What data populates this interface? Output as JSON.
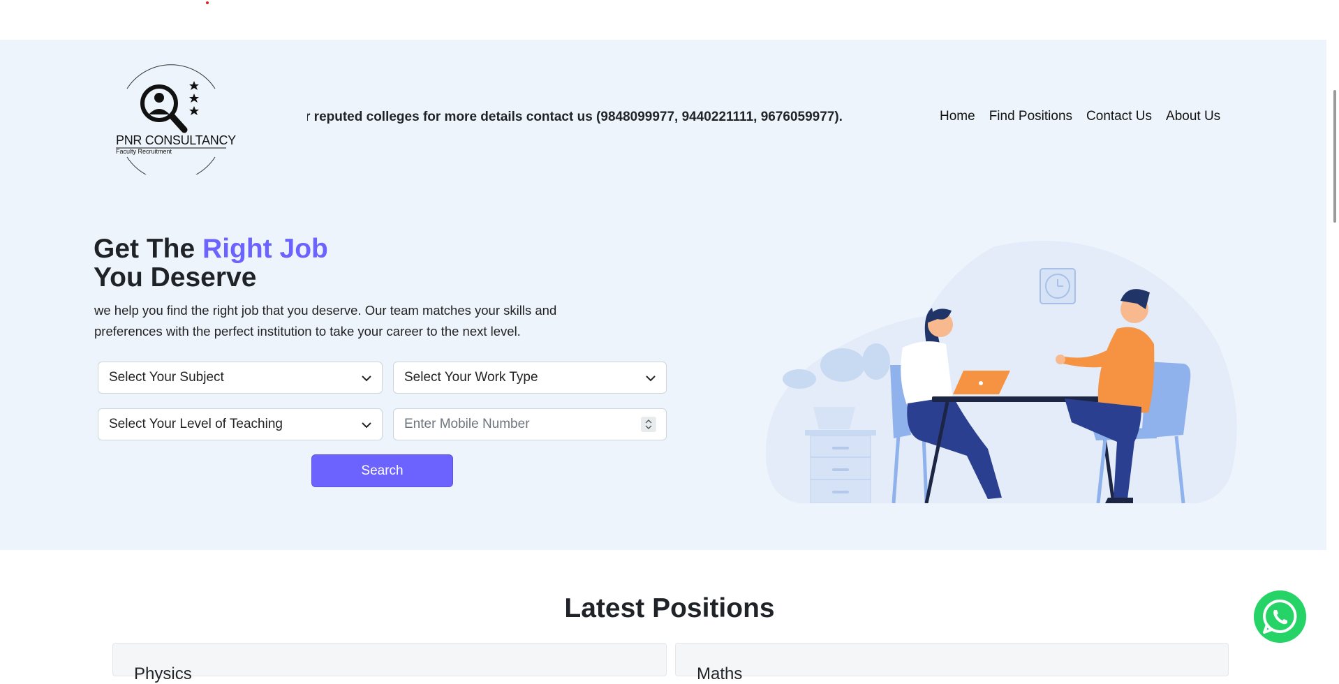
{
  "header": {
    "logo": {
      "brand": "PNR CONSULTANCY",
      "tagline": "Faculty Recruitment"
    },
    "marquee": "r reputed colleges for more details contact us (9848099977, 9440221111, 9676059977).",
    "nav": [
      {
        "label": "Home"
      },
      {
        "label": "Find Positions"
      },
      {
        "label": "Contact Us"
      },
      {
        "label": "About Us"
      }
    ]
  },
  "hero": {
    "title_line1_plain": "Get The ",
    "title_line1_accent": "Right Job",
    "title_line2": "You Deserve",
    "description": "we help you find the right job that you deserve. Our team matches your skills and preferences with the perfect institution to take your career to the next level.",
    "form": {
      "subject": "Select Your Subject",
      "work_type": "Select Your Work Type",
      "level": "Select Your Level of Teaching",
      "mobile_placeholder": "Enter Mobile Number",
      "search_label": "Search"
    }
  },
  "positions": {
    "title": "Latest Positions",
    "cards": [
      {
        "title": "Physics"
      },
      {
        "title": "Maths"
      }
    ]
  },
  "colors": {
    "accent": "#6c63ff",
    "hero_bg": "#eef4fc",
    "whatsapp": "#25d366"
  },
  "icons": [
    "chevron-down-icon",
    "whatsapp-icon",
    "search-person-logo-icon"
  ]
}
